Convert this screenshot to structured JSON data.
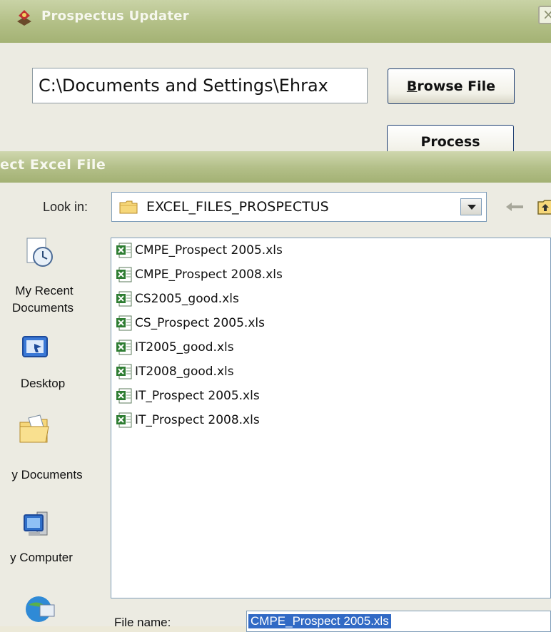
{
  "app": {
    "title": "Prospectus Updater",
    "path_value": "C:\\Documents and Settings\\Ehrax",
    "browse_label": "Browse File",
    "browse_mnemonic": "B",
    "browse_rest": "rowse File",
    "process_label": "Process"
  },
  "dialog": {
    "title": "ect Excel File",
    "look_in_label": "Look in:",
    "look_in_value": "EXCEL_FILES_PROSPECTUS",
    "places": [
      {
        "label_line1": "My Recent",
        "label_line2": "Documents",
        "icon": "recent-documents-icon"
      },
      {
        "label_line1": "Desktop",
        "icon": "desktop-icon"
      },
      {
        "label_line1": "y Documents",
        "icon": "my-documents-icon"
      },
      {
        "label_line1": "y Computer",
        "icon": "my-computer-icon"
      },
      {
        "icon": "network-places-icon"
      }
    ],
    "files": [
      "CMPE_Prospect 2005.xls",
      "CMPE_Prospect 2008.xls",
      "CS2005_good.xls",
      "CS_Prospect 2005.xls",
      "IT2005_good.xls",
      "IT2008_good.xls",
      "IT_Prospect 2005.xls",
      "IT_Prospect 2008.xls"
    ],
    "file_name_label": "File name:",
    "file_name_value": "CMPE_Prospect 2005.xls"
  },
  "colors": {
    "titlebar": "#b2bf86",
    "selection": "#316ac5",
    "button_border": "#1b3b6f"
  }
}
